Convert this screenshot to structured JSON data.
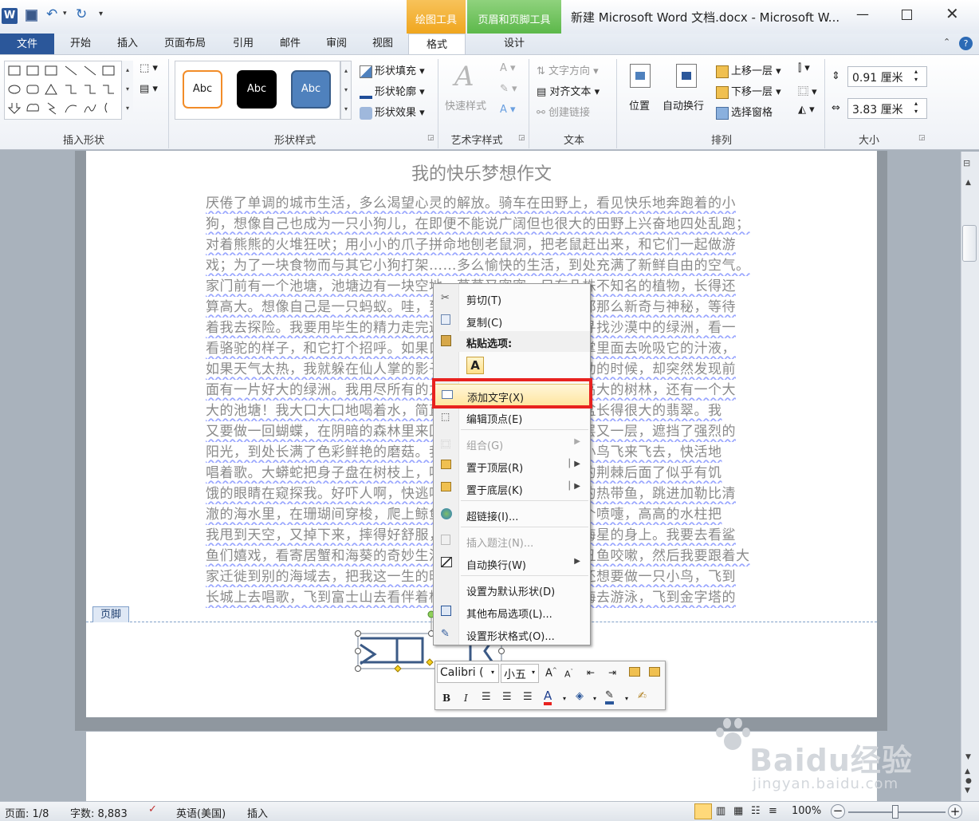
{
  "window": {
    "title": "新建 Microsoft Word 文档.docx - Microsoft W...",
    "app_icon_letter": "W"
  },
  "context_groups": {
    "drawing_tools": "绘图工具",
    "header_footer_tools": "页眉和页脚工具"
  },
  "tabs": [
    {
      "label": "文件"
    },
    {
      "label": "开始"
    },
    {
      "label": "插入"
    },
    {
      "label": "页面布局"
    },
    {
      "label": "引用"
    },
    {
      "label": "邮件"
    },
    {
      "label": "审阅"
    },
    {
      "label": "视图"
    },
    {
      "label": "格式"
    },
    {
      "label": "设计"
    }
  ],
  "ribbon": {
    "groups": {
      "insert_shapes": "插入形状",
      "shape_styles": "形状样式",
      "wordart_styles": "艺术字样式",
      "text": "文本",
      "arrange": "排列",
      "size": "大小"
    },
    "style_presets": [
      "Abc",
      "Abc",
      "Abc"
    ],
    "shape_fill": "形状填充",
    "shape_outline": "形状轮廓",
    "shape_effects": "形状效果",
    "quick_styles": "快速样式",
    "text_direction": "文字方向",
    "align_text": "对齐文本",
    "create_link": "创建链接",
    "position": "位置",
    "wrap_text": "自动换行",
    "bring_forward": "上移一层",
    "send_backward": "下移一层",
    "selection_pane": "选择窗格",
    "height": "0.91 厘米",
    "width": "3.83 厘米"
  },
  "document": {
    "title": "我的快乐梦想作文",
    "lines": [
      "厌倦了单调的城市生活，多么渴望心灵的解放。骑车在田野上，看见快乐地奔跑着的小",
      "狗，想像自己也成为一只小狗儿，在即便不能说广阔但也很大的田野上兴奋地四处乱跑；",
      "对着熊熊的火堆狂吠；用小小的爪子拼命地刨老鼠洞，把老鼠赶出来，和它们一起做游",
      "戏；为了一块食物而与其它小狗打架……多么愉快的生活，到处充满了新鲜自由的空气。",
      "家门前有一个池塘，池塘边有一块空地，草草又密密，只有几株不知名的植物，长得还",
      "算高大。想像自己是一只蚂蚁。哇，到处都是那么高大，到处都那么新奇与神秘，等待",
      "着我去探险。我要用毕生的精力走完这块地，要走到沙漠中去寻找沙漠中的绿洲，看一",
      "看骆驼的样子，和它打个招呼。如果口渴了，就钻到一株仙人掌里面去吮吸它的汁液，",
      "如果天气太热，我就躲在仙人掌的影子下乘凉。当我快要走不动的时候，却突然发现前",
      "面有一片好大的绿洲。我用尽所有的力气向前跑，那里有很多高大的树林，还有一个大",
      "大的池塘！我大口大口地喝着水，简直太舒服了。原来只是一盆长得很大的翡翠。我",
      "又要做一回蝴蝶，在阴暗的森林里来回地飞舞，茂密的树叶一层又一层，遮挡了强烈的",
      "阳光，到处长满了色彩鲜艳的磨菇。我飞呀飞呀，看见美丽的小鸟飞来飞去，快活地",
      "唱着歌。大蟒蛇把身子盘在树枝上，吐着信子，好像在一大片的荆棘后面了似乎有饥",
      "饿的眼睛在窥探我。好吓人啊，快逃吧！我还要变成一条小小的热带鱼，跳进加勒比清",
      "澈的海水里，在珊瑚间穿梭，爬上鲸鱼的背，那条鲸鱼就打了个喷嚏，高高的水柱把",
      "我甩到天空，又掉下来，摔得好舒服，原来是落在一只大大的海星的身上。我要去看鲨",
      "鱼们嬉戏，看寄居蟹和海葵的奇妙生活，偷偷地躲在一边和小丑鱼咬嗽，然后我要跟着大",
      "家迁徙到别的海域去，把我这一生的时间都用来旅行。然后我还想要做一只小鸟，飞到",
      "长城上去唱歌，飞到富士山去看伴着樱花的富士山，飞到地中海去游泳，飞到金字塔的"
    ],
    "footer_label": "页脚"
  },
  "context_menu": {
    "items": [
      {
        "label": "剪切(T)"
      },
      {
        "label": "复制(C)"
      },
      {
        "label": "粘贴选项:"
      },
      {
        "label": "A"
      },
      {
        "label": "添加文字(X)"
      },
      {
        "label": "编辑顶点(E)"
      },
      {
        "label": "组合(G)"
      },
      {
        "label": "置于顶层(R)"
      },
      {
        "label": "置于底层(K)"
      },
      {
        "label": "超链接(I)..."
      },
      {
        "label": "插入题注(N)..."
      },
      {
        "label": "自动换行(W)"
      },
      {
        "label": "设置为默认形状(D)"
      },
      {
        "label": "其他布局选项(L)..."
      },
      {
        "label": "设置形状格式(O)..."
      }
    ],
    "highlight_color": "#e8221f"
  },
  "mini_toolbar": {
    "font": "Calibri (",
    "size": "小五"
  },
  "status": {
    "page": "页面: 1/8",
    "words": "字数: 8,883",
    "language": "英语(美国)",
    "mode": "插入",
    "zoom": "100%"
  },
  "watermark": {
    "brand": "Baidu经验",
    "url": "jingyan.baidu.com"
  },
  "colors": {
    "file_tab": "#2b579a",
    "drawing_tools": "#f0a61e",
    "header_footer_tools": "#5cb84a"
  }
}
